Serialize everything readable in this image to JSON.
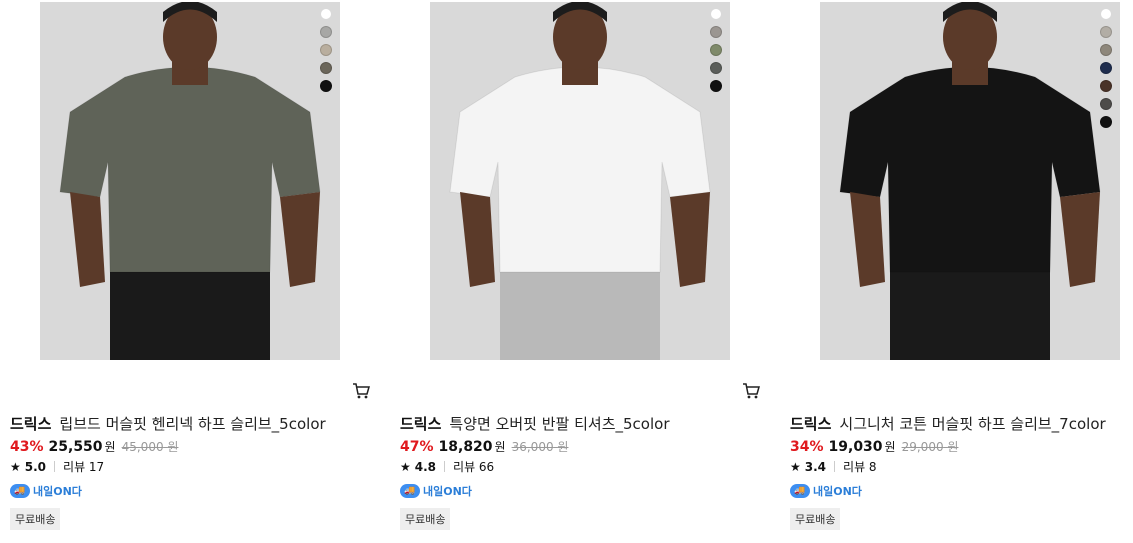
{
  "products": [
    {
      "brand": "드릭스",
      "name": "립브드 머슬핏 헨리넥 하프 슬리브_5color",
      "discount": "43%",
      "sale_price": "25,550",
      "currency": "원",
      "original_price": "45,000",
      "original_currency": "원",
      "rating": "5.0",
      "reviews": "리뷰 17",
      "delivery": "내일ON다",
      "badge": "무료배송",
      "shirt_color": "#5f6358",
      "swatches": [
        "#ffffff",
        "#a7a7a5",
        "#b9ae9e",
        "#6b665a",
        "#111111"
      ]
    },
    {
      "brand": "드릭스",
      "name": "특양면 오버핏 반팔 티셔츠_5color",
      "discount": "47%",
      "sale_price": "18,820",
      "currency": "원",
      "original_price": "36,000",
      "original_currency": "원",
      "rating": "4.8",
      "reviews": "리뷰 66",
      "delivery": "내일ON다",
      "badge": "무료배송",
      "shirt_color": "#f4f4f4",
      "swatches": [
        "#ffffff",
        "#9b9691",
        "#7f8a6a",
        "#5b5e5a",
        "#111111"
      ]
    },
    {
      "brand": "드릭스",
      "name": "시그니처 코튼 머슬핏 하프 슬리브_7color",
      "discount": "34%",
      "sale_price": "19,030",
      "currency": "원",
      "original_price": "29,000",
      "original_currency": "원",
      "rating": "3.4",
      "reviews": "리뷰 8",
      "delivery": "내일ON다",
      "badge": "무료배송",
      "shirt_color": "#141414",
      "swatches": [
        "#ffffff",
        "#b2ada5",
        "#8e877b",
        "#1f2d4e",
        "#4a3328",
        "#4d4c4a",
        "#111111"
      ]
    }
  ],
  "icons": {
    "cart": "cart-icon",
    "star": "star-icon",
    "delivery": "delivery-truck-icon"
  },
  "colors": {
    "discount": "#e0191e",
    "delivery": "#2b7ed8"
  }
}
